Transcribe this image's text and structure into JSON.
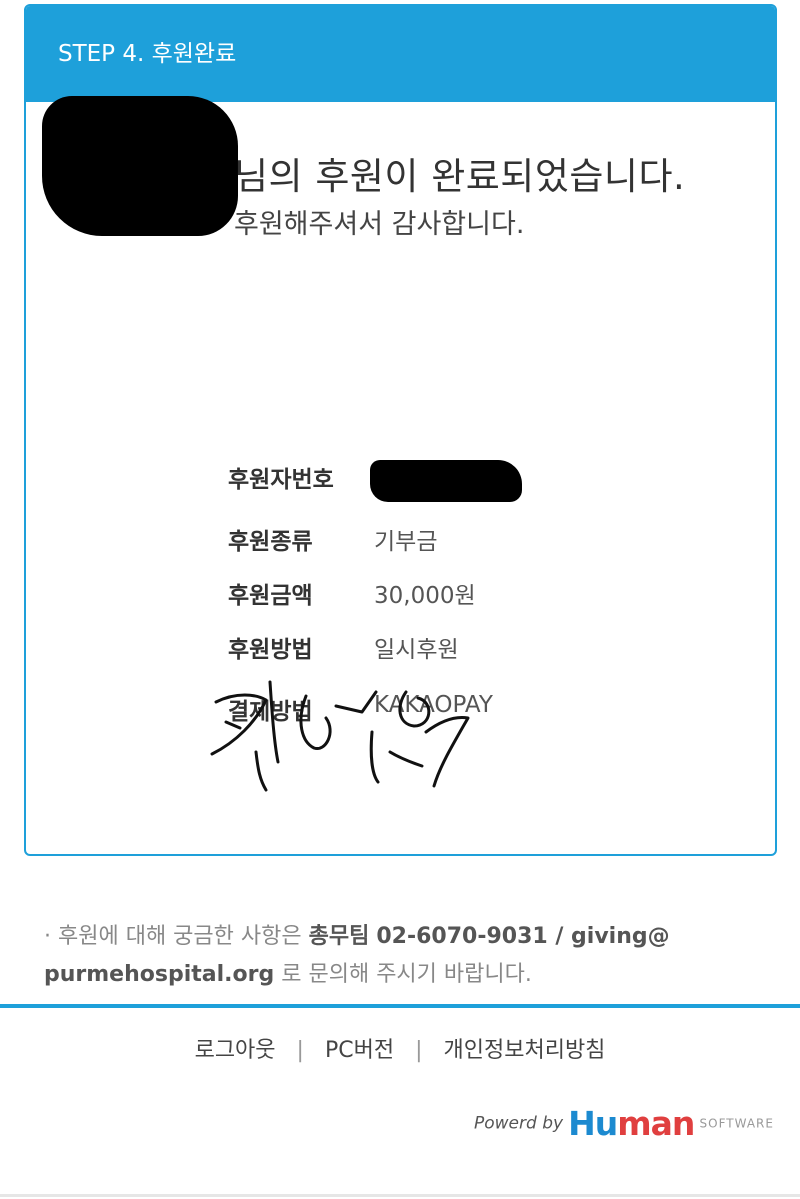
{
  "step_title": "STEP 4. 후원완료",
  "headline": "님의 후원이 완료되었습니다.",
  "subline": "후원해주셔서 감사합니다.",
  "details": [
    {
      "label": "후원자번호",
      "value": ""
    },
    {
      "label": "후원종류",
      "value": "기부금"
    },
    {
      "label": "후원금액",
      "value": "30,000원"
    },
    {
      "label": "후원방법",
      "value": "일시후원"
    },
    {
      "label": "결제방법",
      "value": "KAKAOPAY"
    }
  ],
  "notice": {
    "prefix": "· 후원에 대해 궁금한 사항은",
    "team": "총무팀",
    "contact": "02-6070-9031 / giving@",
    "email_domain": "purmehospital.org",
    "suffix": "로 문의해 주시기 바랍니다."
  },
  "footer": {
    "logout": "로그아웃",
    "pc_version": "PC버전",
    "privacy": "개인정보처리방침"
  },
  "powered": {
    "by": "Powerd by",
    "logo_hu": "Hu",
    "logo_man": "man",
    "software": "SOFTWARE"
  },
  "colors": {
    "accent": "#1ea0da",
    "logo_blue": "#1c8ad0",
    "logo_red": "#e03f3f"
  }
}
